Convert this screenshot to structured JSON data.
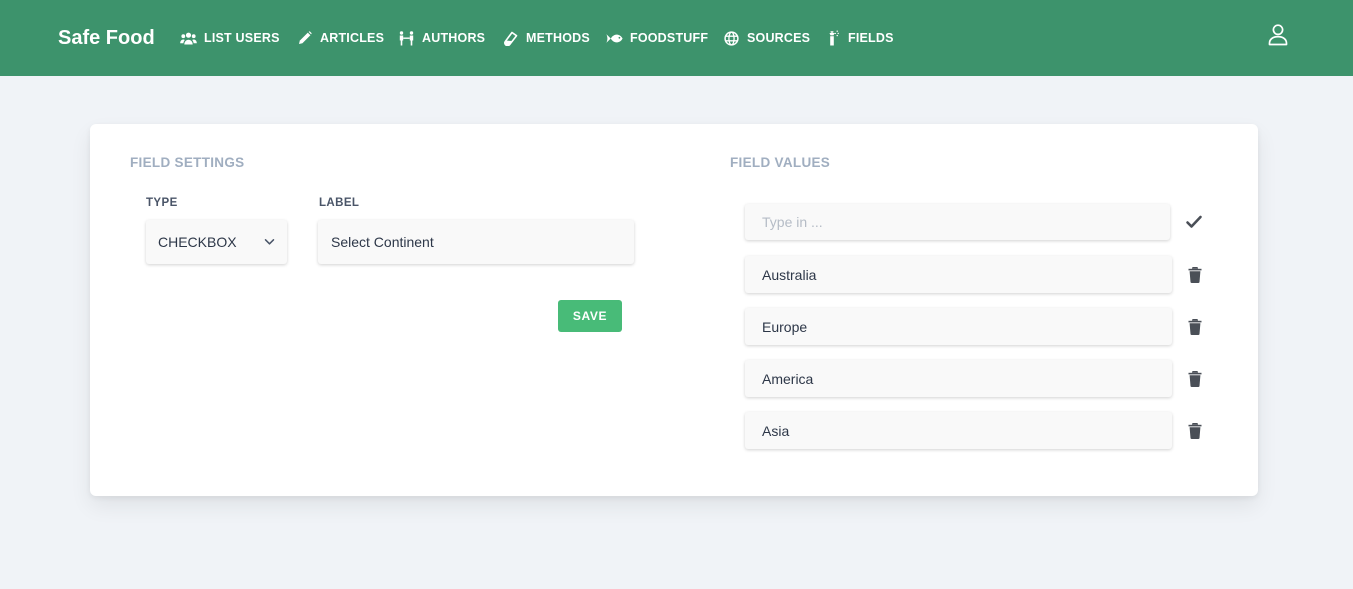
{
  "app": {
    "brand": "Safe Food"
  },
  "nav": {
    "items": [
      {
        "label": "LIST USERS",
        "icon": "users-icon"
      },
      {
        "label": "ARTICLES",
        "icon": "pencil-icon"
      },
      {
        "label": "AUTHORS",
        "icon": "people-icon"
      },
      {
        "label": "METHODS",
        "icon": "flask-icon"
      },
      {
        "label": "FOODSTUFF",
        "icon": "fish-icon"
      },
      {
        "label": "SOURCES",
        "icon": "globe-icon"
      },
      {
        "label": "FIELDS",
        "icon": "spray-icon"
      }
    ]
  },
  "user_menu": {
    "icon": "user-icon"
  },
  "field_settings": {
    "title": "FIELD SETTINGS",
    "type_label": "TYPE",
    "type_value": "CHECKBOX",
    "label_label": "LABEL",
    "label_value": "Select Continent",
    "save_label": "SAVE"
  },
  "field_values": {
    "title": "FIELD VALUES",
    "new_value_placeholder": "Type in ...",
    "new_value": "",
    "values": [
      "Australia",
      "Europe",
      "America",
      "Asia"
    ]
  },
  "colors": {
    "header": "#3d936c",
    "save_button": "#48bb78",
    "background": "#f0f3f7",
    "icon_dark": "#4a4f57"
  }
}
